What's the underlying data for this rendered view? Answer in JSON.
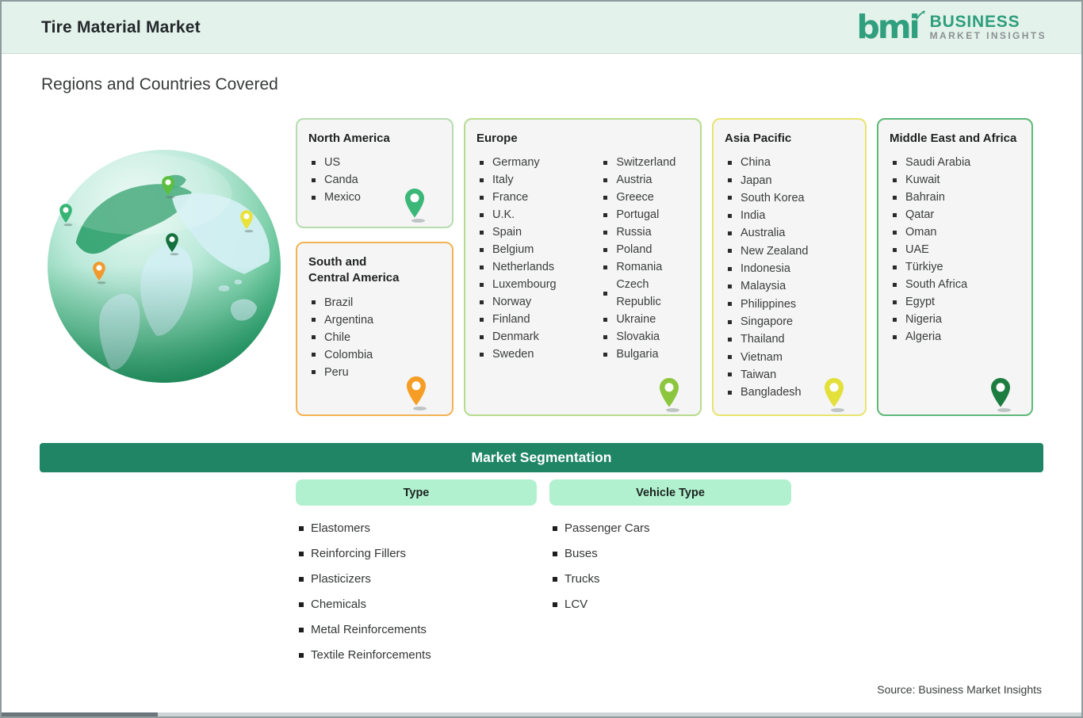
{
  "header": {
    "title": "Tire Material Market",
    "logo": {
      "mark": "bmi",
      "name_line1": "BUSINESS",
      "name_line2": "MARKET  INSIGHTS"
    }
  },
  "page_title": "Regions and Countries Covered",
  "regions": [
    {
      "id": "na",
      "name": "North America",
      "border_color": "#b5ddae",
      "pin_color": "#3bb878",
      "columns": [
        [
          "US",
          "Canda",
          "Mexico"
        ]
      ]
    },
    {
      "id": "sca",
      "name": "South and Central America",
      "border_color": "#f2b353",
      "pin_color": "#f59d24",
      "columns": [
        [
          "Brazil",
          "Argentina",
          "Chile",
          "Colombia",
          "Peru"
        ]
      ]
    },
    {
      "id": "eu",
      "name": "Europe",
      "border_color": "#b6db8d",
      "pin_color": "#8cc63e",
      "columns": [
        [
          "Germany",
          "Italy",
          "France",
          "U.K.",
          "Spain",
          "Belgium",
          "Netherlands",
          "Luxembourg",
          "Norway",
          "Finland",
          "Denmark",
          "Sweden"
        ],
        [
          "Switzerland",
          "Austria",
          "Greece",
          "Portugal",
          "Russia",
          "Poland",
          "Romania",
          "Czech Republic",
          "Ukraine",
          "Slovakia",
          "Bulgaria"
        ]
      ]
    },
    {
      "id": "ap",
      "name": "Asia Pacific",
      "border_color": "#e9e46e",
      "pin_color": "#e3e03c",
      "columns": [
        [
          "China",
          "Japan",
          "South Korea",
          "India",
          "Australia",
          "New Zealand",
          "Indonesia",
          "Malaysia",
          "Philippines",
          "Singapore",
          "Thailand",
          "Vietnam",
          "Taiwan",
          "Bangladesh"
        ]
      ]
    },
    {
      "id": "mea",
      "name": "Middle East and Africa",
      "border_color": "#5fb878",
      "pin_color": "#1d7c40",
      "columns": [
        [
          "Saudi Arabia",
          "Kuwait",
          "Bahrain",
          "Qatar",
          "Oman",
          "UAE",
          "Türkiye",
          "South Africa",
          "Egypt",
          "Nigeria",
          "Algeria"
        ]
      ]
    }
  ],
  "globe": {
    "pins": [
      {
        "color": "#35b573"
      },
      {
        "color": "#5bbf3e"
      },
      {
        "color": "#e8e23a"
      },
      {
        "color": "#14713d"
      },
      {
        "color": "#f2992e"
      }
    ]
  },
  "segmentation": {
    "title": "Market Segmentation",
    "bar_color": "#1f8565",
    "chip_color": "#b1f1cf",
    "groups": [
      {
        "label": "Type",
        "items": [
          "Elastomers",
          "Reinforcing Fillers",
          "Plasticizers",
          "Chemicals",
          "Metal Reinforcements",
          "Textile Reinforcements"
        ]
      },
      {
        "label": "Vehicle Type",
        "items": [
          "Passenger Cars",
          "Buses",
          "Trucks",
          "LCV"
        ]
      }
    ]
  },
  "source": "Source: Business Market Insights",
  "colors": {
    "header_bg": "#e3f2eb",
    "logo_green": "#2f9f7d",
    "logo_gray": "#8b9192",
    "card_bg": "#f5f5f5"
  }
}
